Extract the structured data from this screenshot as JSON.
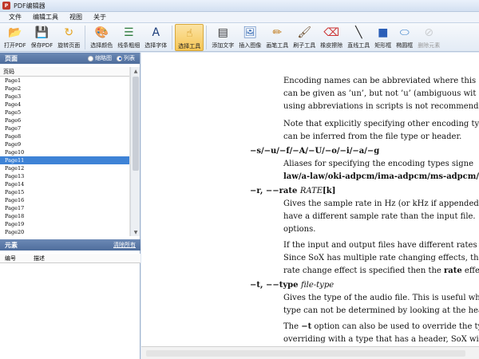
{
  "window": {
    "title": "PDF编辑器"
  },
  "menu": [
    "文件",
    "编辑工具",
    "视图",
    "关于"
  ],
  "toolbar": [
    {
      "label": "打开PDF",
      "icon": "open-folder-icon",
      "glyph": "📂"
    },
    {
      "label": "保存PDF",
      "icon": "save-disk-icon",
      "glyph": "💾"
    },
    {
      "label": "旋转页面",
      "icon": "rotate-icon",
      "glyph": "↻"
    },
    {
      "label": "选择颜色",
      "icon": "palette-icon",
      "glyph": "🎨"
    },
    {
      "label": "线条粗细",
      "icon": "line-width-icon",
      "glyph": "☰"
    },
    {
      "label": "选择字体",
      "icon": "font-icon",
      "glyph": "A"
    },
    {
      "label": "选择工具",
      "icon": "pointer-icon",
      "glyph": "☝"
    },
    {
      "label": "添加文字",
      "icon": "add-text-icon",
      "glyph": "▤"
    },
    {
      "label": "插入图像",
      "icon": "insert-image-icon",
      "glyph": "🖼"
    },
    {
      "label": "画笔工具",
      "icon": "pen-icon",
      "glyph": "✏"
    },
    {
      "label": "刷子工具",
      "icon": "brush-icon",
      "glyph": "🖌"
    },
    {
      "label": "橡皮擦除",
      "icon": "eraser-icon",
      "glyph": "⌫"
    },
    {
      "label": "直线工具",
      "icon": "line-icon",
      "glyph": "╲"
    },
    {
      "label": "矩形框",
      "icon": "rectangle-icon",
      "glyph": "■"
    },
    {
      "label": "椭圆框",
      "icon": "ellipse-icon",
      "glyph": "⬭"
    },
    {
      "label": "删除元素",
      "icon": "delete-icon",
      "glyph": "⊘"
    }
  ],
  "pages_panel": {
    "title": "页面",
    "view_thumbnail": "缩略图",
    "view_list": "列表",
    "column": "页码",
    "pages": [
      "Page1",
      "Page2",
      "Page3",
      "Page4",
      "Page5",
      "Page6",
      "Page7",
      "Page8",
      "Page9",
      "Page10",
      "Page11",
      "Page12",
      "Page13",
      "Page14",
      "Page15",
      "Page16",
      "Page17",
      "Page18",
      "Page19",
      "Page20"
    ],
    "selected_index": 10
  },
  "elements_panel": {
    "title": "元素",
    "clear_all": "清除所有",
    "col_id": "编号",
    "col_desc": "描述"
  },
  "document": {
    "p1": [
      "Encoding names can be abbreviated where this",
      "can be given as ’un’, but not ’u’ (ambiguous wit",
      "using abbreviations in scripts is not recommended"
    ],
    "p2": [
      "Note that explicitly specifying other encoding typ",
      "can be inferred from the file type or header."
    ],
    "opt1": "−s/−u/−f/−A/−U/−o/−i/−a/−g",
    "p3": [
      "Aliases for specifying the encoding types signe",
      "law/a-law/oki-adpcm/ima-adpcm/ms-adpcm/gs"
    ],
    "opt2_prefix": "−r, −−rate ",
    "opt2_arg": "RATE",
    "opt2_suffix": "[k]",
    "p4": [
      "Gives the sample rate in Hz (or kHz if appended",
      "have a different sample rate than the input file.",
      "options."
    ],
    "p5": [
      "If the input and output files have different rates",
      "Since SoX has multiple rate changing effects, the",
      "rate change effect is specified then the "
    ],
    "p5_bold": "rate",
    "p5_end": " effect",
    "opt3_prefix": "−t, −−type ",
    "opt3_arg": "file-type",
    "p6": [
      "Gives the type of the audio file.  This is useful wh",
      "type can not be determined by looking at the head"
    ],
    "p7_start": "The ",
    "p7_bold": "−t",
    "p7_rest": " option can also be used to override the typ",
    "p7_line2": "overriding with a type that has a header, SoX will"
  }
}
